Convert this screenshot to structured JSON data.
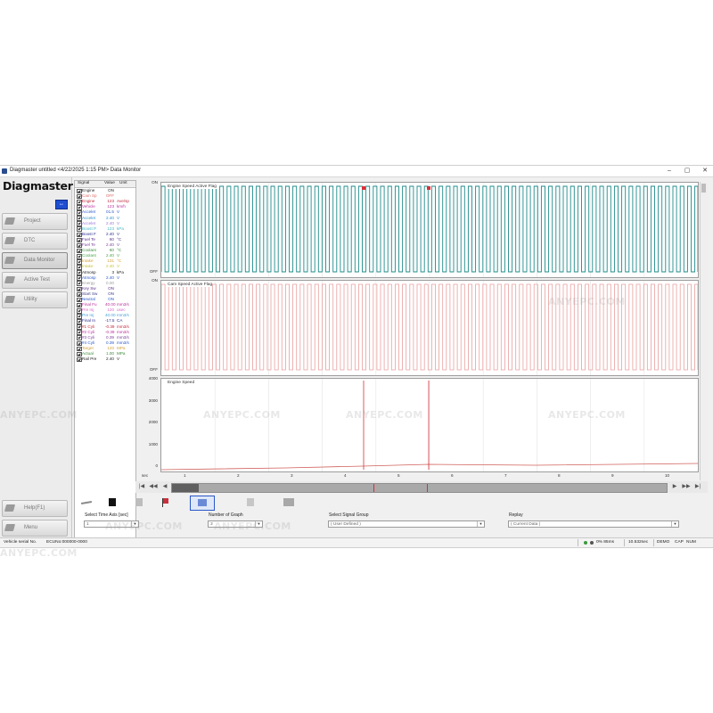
{
  "window": {
    "title": "Diagmaster untitled <4/22/2025 1:15 PM> Data Monitor",
    "minimize": "–",
    "maximize": "▢",
    "close": "✕"
  },
  "sidebar": {
    "brand": "Diagmaster",
    "link_button": "↔",
    "items": [
      {
        "label": "Project",
        "icon": "project-icon"
      },
      {
        "label": "DTC",
        "icon": "dtc-icon"
      },
      {
        "label": "Data Monitor",
        "icon": "data-monitor-icon",
        "active": true
      },
      {
        "label": "Active Test",
        "icon": "active-test-icon"
      },
      {
        "label": "Utility",
        "icon": "gear-icon"
      }
    ],
    "help_label": "Help(F1)",
    "menu_label": "Menu"
  },
  "signal_table": {
    "headers": [
      "Signal",
      "Value",
      "Unit"
    ],
    "rows": [
      {
        "name": "Engine",
        "value": "ON",
        "unit": "",
        "color": "#222222"
      },
      {
        "name": "Cam Sp",
        "value": "OFF",
        "unit": "",
        "color": "#e06a6a"
      },
      {
        "name": "Engine",
        "value": "123",
        "unit": "Ave/sp",
        "color": "#c0283d"
      },
      {
        "name": "Vehicle",
        "value": "123",
        "unit": "km/h",
        "color": "#b8309a"
      },
      {
        "name": "Accelet",
        "value": "01.5",
        "unit": "V",
        "color": "#2a57c9"
      },
      {
        "name": "Accelet",
        "value": "2.40",
        "unit": "V",
        "color": "#2a8bc9"
      },
      {
        "name": "Accelet",
        "value": "2.40",
        "unit": "V",
        "color": "#9a78d6"
      },
      {
        "name": "Boost P",
        "value": "123",
        "unit": "kPa",
        "color": "#47b7c9"
      },
      {
        "name": "Boost F",
        "value": "2.40",
        "unit": "V",
        "color": "#2c2f8f"
      },
      {
        "name": "Fuel Te",
        "value": "60",
        "unit": "°C",
        "color": "#5a2d8a"
      },
      {
        "name": "Fuel Te",
        "value": "2.40",
        "unit": "V",
        "color": "#7a3d98"
      },
      {
        "name": "Coolant",
        "value": "60",
        "unit": "°C",
        "color": "#3d8a3d"
      },
      {
        "name": "Coolant",
        "value": "2.40",
        "unit": "V",
        "color": "#4aa24a"
      },
      {
        "name": "Intake",
        "value": "131",
        "unit": "°C",
        "color": "#d6a23a"
      },
      {
        "name": "Intake",
        "value": "2.40",
        "unit": "V",
        "color": "#c9c23a"
      },
      {
        "name": "Atmosp",
        "value": "3",
        "unit": "kPa",
        "color": "#222222"
      },
      {
        "name": "Atmosp",
        "value": "2.40",
        "unit": "V",
        "color": "#2a57c9"
      },
      {
        "name": "Energy",
        "value": "0.00",
        "unit": "",
        "color": "#9a9a9a"
      },
      {
        "name": "Key Sw",
        "value": "ON",
        "unit": "",
        "color": "#5a2d8a"
      },
      {
        "name": "Start Sw",
        "value": "ON",
        "unit": "",
        "color": "#3d3d8a"
      },
      {
        "name": "Neutral",
        "value": "ON",
        "unit": "",
        "color": "#2a57c9"
      },
      {
        "name": "Final Fu",
        "value": "40.00",
        "unit": "mm3/s",
        "color": "#b8309a"
      },
      {
        "name": "Pre Inj",
        "value": "120",
        "unit": "usec",
        "color": "#d667c9"
      },
      {
        "name": "Pre Inj",
        "value": "40.00",
        "unit": "mm3/s",
        "color": "#4aa2d6"
      },
      {
        "name": "Final In",
        "value": "-17.5",
        "unit": "CA",
        "color": "#2c2f8f"
      },
      {
        "name": "#1 Cyli",
        "value": "-0.39",
        "unit": "mm3/s",
        "color": "#c0283d"
      },
      {
        "name": "#2 Cyli",
        "value": "-0.39",
        "unit": "mm3/s",
        "color": "#b8309a"
      },
      {
        "name": "#3 Cyli",
        "value": "0.39",
        "unit": "mm3/s",
        "color": "#7a3d98"
      },
      {
        "name": "#4 Cyli",
        "value": "0.39",
        "unit": "mm3/s",
        "color": "#2a57c9"
      },
      {
        "name": "Target",
        "value": "120",
        "unit": "MPa",
        "color": "#d6a23a"
      },
      {
        "name": "Actual",
        "value": "1.00",
        "unit": "MPa",
        "color": "#3d8a3d"
      },
      {
        "name": "Rail Pre",
        "value": "2.40",
        "unit": "V",
        "color": "#222222"
      }
    ]
  },
  "graphs": [
    {
      "title": "Engine Speed Active Flag",
      "y_top": "ON",
      "y_bottom": "OFF",
      "color": "#1f8a8a"
    },
    {
      "title": "Cam Speed Active Flag",
      "y_top": "ON",
      "y_bottom": "OFF",
      "color": "#e8a0a0"
    },
    {
      "title": "Engine Speed",
      "y_ticks": [
        "4000",
        "3000",
        "2000",
        "1000",
        "0"
      ],
      "color": "#d0605a"
    }
  ],
  "time_axis": {
    "unit_label": "sec",
    "ticks": [
      "1",
      "2",
      "3",
      "4",
      "5",
      "6",
      "7",
      "8",
      "9",
      "10"
    ]
  },
  "time_nav": {
    "first": "|◀",
    "prev_big": "◀◀",
    "prev": "◀",
    "next": "▶",
    "next_big": "▶▶",
    "last": "▶|"
  },
  "controls": {
    "time_axis": {
      "label": "Select Time Axis [sec]",
      "value": "1"
    },
    "graph_count": {
      "label": "Number of Graph",
      "value": "3"
    },
    "signal_group": {
      "label": "Select Signal Group",
      "value": "( User Defined )"
    },
    "replay": {
      "label": "Replay",
      "value": "( Current Data )"
    }
  },
  "status": {
    "left": "Vehicle serial No.",
    "ecu": "ECUNo:000000-0000",
    "load": "0%  85ms",
    "elapsed": "10.532sec",
    "mode": "DEMO",
    "caps": "CAP",
    "num": "NUM"
  },
  "watermark": "ANYEPC.COM",
  "colors": {
    "pulse_teal": "#1f8a8a",
    "pulse_pink": "#e8a0a0",
    "marker_red": "#d8303a",
    "brand_blue": "#1f4fd1"
  }
}
